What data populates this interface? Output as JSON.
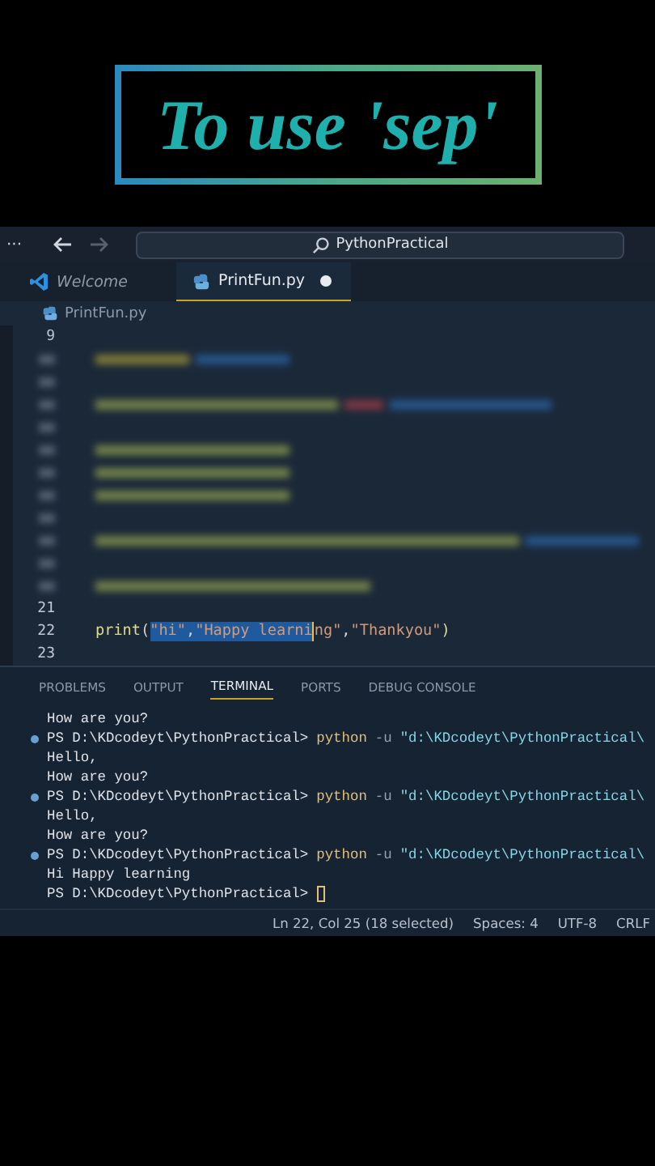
{
  "overlay_title": "To use 'sep'",
  "title_bar": {
    "menu": "···",
    "back": {
      "disabled": false
    },
    "forward": {
      "disabled": true
    },
    "search": "PythonPractical"
  },
  "tabs": [
    {
      "label": "Welcome",
      "kind": "welcome",
      "selected": false,
      "modified": false
    },
    {
      "label": "PrintFun.py",
      "kind": "python",
      "selected": true,
      "modified": true
    }
  ],
  "breadcrumb": "PrintFun.py",
  "editor_lines": [
    {
      "kind": "plain",
      "number": "9"
    },
    {
      "kind": "blurred"
    },
    {
      "kind": "blurred_gap"
    },
    {
      "kind": "blurred"
    },
    {
      "kind": "blurred_gap"
    },
    {
      "kind": "blurred"
    },
    {
      "kind": "blurred"
    },
    {
      "kind": "blurred"
    },
    {
      "kind": "blurred_gap"
    },
    {
      "kind": "blurred"
    },
    {
      "kind": "blurred_gap"
    },
    {
      "kind": "blurred"
    },
    {
      "kind": "plain",
      "number": "21"
    },
    {
      "kind": "code",
      "number": "22",
      "tokens": [
        {
          "text": "print",
          "kind": "function",
          "selected": false
        },
        {
          "text": "(",
          "kind": "punct",
          "selected": false
        },
        {
          "text": "\"hi\"",
          "kind": "string",
          "selected": true
        },
        {
          "text": ",",
          "kind": "punct",
          "selected": true
        },
        {
          "text": "\"Happy learni",
          "kind": "string",
          "selected": true
        },
        {
          "text": "ng\"",
          "kind": "string",
          "selected": false,
          "cursor_before": true
        },
        {
          "text": ",",
          "kind": "punct",
          "selected": false
        },
        {
          "text": "\"Thankyou\"",
          "kind": "string",
          "selected": false
        },
        {
          "text": ")",
          "kind": "function",
          "selected": false
        }
      ]
    },
    {
      "kind": "plain",
      "number": "23"
    }
  ],
  "panel_tabs": [
    {
      "label": "PROBLEMS",
      "selected": false
    },
    {
      "label": "OUTPUT",
      "selected": false
    },
    {
      "label": "TERMINAL",
      "selected": true
    },
    {
      "label": "PORTS",
      "selected": false
    },
    {
      "label": "DEBUG CONSOLE",
      "selected": false
    }
  ],
  "terminal_lines": [
    {
      "kind": "output",
      "text": " How are you?"
    },
    {
      "kind": "prompt",
      "prompt": "PS D:\\KDcodeyt\\PythonPractical>",
      "command": "python",
      "args": "-u",
      "path": "\"d:\\KDcodeyt\\PythonPractical\\"
    },
    {
      "kind": "output",
      "text": "Hello,"
    },
    {
      "kind": "output",
      "text": "How are you?"
    },
    {
      "kind": "prompt",
      "prompt": "PS D:\\KDcodeyt\\PythonPractical>",
      "command": "python",
      "args": "-u",
      "path": "\"d:\\KDcodeyt\\PythonPractical\\"
    },
    {
      "kind": "output",
      "text": "Hello,"
    },
    {
      "kind": "output",
      "text": " How are you?"
    },
    {
      "kind": "prompt",
      "prompt": "PS D:\\KDcodeyt\\PythonPractical>",
      "command": "python",
      "args": "-u",
      "path": "\"d:\\KDcodeyt\\PythonPractical\\"
    },
    {
      "kind": "output",
      "text": "Hi Happy learning"
    },
    {
      "kind": "input",
      "prompt": "PS D:\\KDcodeyt\\PythonPractical>"
    }
  ],
  "status_bar": [
    "Ln 22, Col 25 (18 selected)",
    "Spaces: 4",
    "UTF-8",
    "CRLF"
  ]
}
